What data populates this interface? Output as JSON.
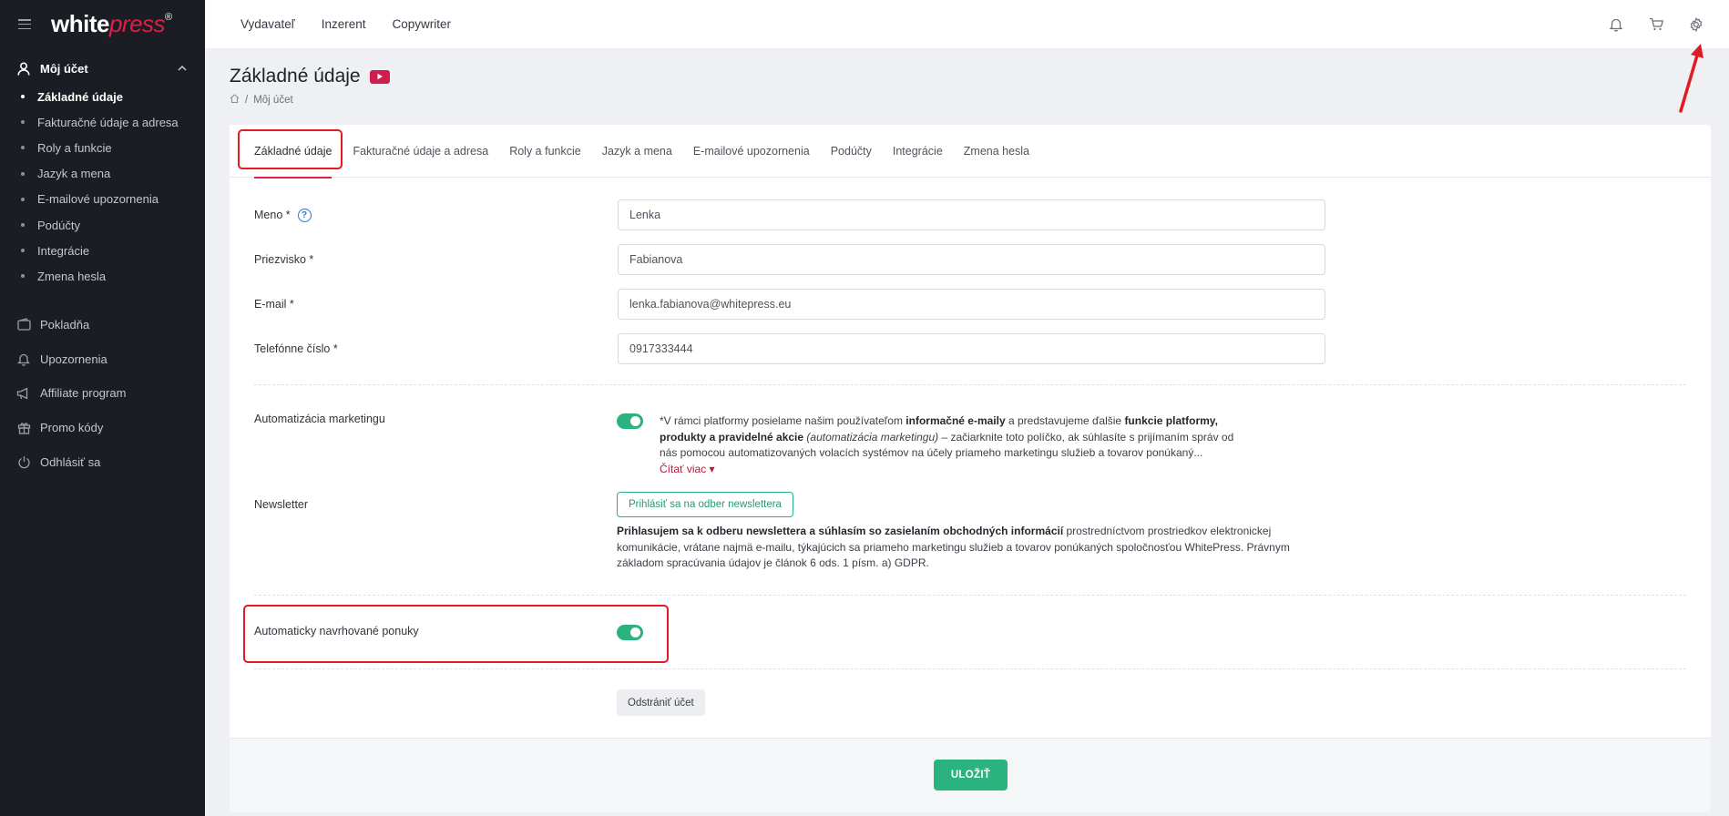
{
  "logo": {
    "main": "white",
    "accent": "press",
    "mark": "®"
  },
  "sidebar": {
    "section": {
      "label": "Môj účet",
      "icon": "user-icon"
    },
    "subitems": [
      {
        "label": "Základné údaje",
        "active": true
      },
      {
        "label": "Fakturačné údaje a adresa"
      },
      {
        "label": "Roly a funkcie"
      },
      {
        "label": "Jazyk a mena"
      },
      {
        "label": "E-mailové upozornenia"
      },
      {
        "label": "Podúčty"
      },
      {
        "label": "Integrácie"
      },
      {
        "label": "Zmena hesla"
      }
    ],
    "main": [
      {
        "label": "Pokladňa",
        "icon": "wallet-icon"
      },
      {
        "label": "Upozornenia",
        "icon": "bell-icon"
      },
      {
        "label": "Affiliate program",
        "icon": "megaphone-icon"
      },
      {
        "label": "Promo kódy",
        "icon": "gift-icon"
      },
      {
        "label": "Odhlásiť sa",
        "icon": "power-icon"
      }
    ]
  },
  "topnav": [
    "Vydavateľ",
    "Inzerent",
    "Copywriter"
  ],
  "page": {
    "title": "Základné údaje",
    "breadcrumb": {
      "sep": "/",
      "current": "Môj účet"
    }
  },
  "tabs": [
    "Základné údaje",
    "Fakturačné údaje a adresa",
    "Roly a funkcie",
    "Jazyk a mena",
    "E-mailové upozornenia",
    "Podúčty",
    "Integrácie",
    "Zmena hesla"
  ],
  "form": {
    "name": {
      "label": "Meno *",
      "value": "Lenka",
      "help": "?"
    },
    "surname": {
      "label": "Priezvisko *",
      "value": "Fabianova"
    },
    "email": {
      "label": "E-mail *",
      "value": "lenka.fabianova@whitepress.eu"
    },
    "phone": {
      "label": "Telefónne číslo *",
      "value": "0917333444"
    }
  },
  "marketing": {
    "label": "Automatizácia marketingu",
    "enabled": true,
    "text_prefix": "*V rámci platformy posielame našim používateľom ",
    "text_b1": "informačné e-maily",
    "text_mid1": " a predstavujeme ďalšie ",
    "text_b2": "funkcie platformy, produkty a pravidelné akcie",
    "text_i": " (automatizácia marketingu)",
    "text_rest": " – začiarknite toto políčko, ak súhlasíte s prijímaním správ od nás pomocou automatizovaných volacích systémov na účely priameho marketingu služieb a tovarov ponúkaný...",
    "read_more": "Čítať viac ▾"
  },
  "newsletter": {
    "label": "Newsletter",
    "button": "Prihlásiť sa na odber newslettera",
    "text_b": "Prihlasujem sa k odberu newslettera a súhlasím so zasielaním obchodných informácií",
    "text_rest": " prostredníctvom prostriedkov elektronickej komunikácie, vrátane najmä e-mailu, týkajúcich sa priameho marketingu služieb a tovarov ponúkaných spoločnosťou WhitePress. Právnym základom spracúvania údajov je článok 6 ods. 1 písm. a) GDPR."
  },
  "auto_offers": {
    "label": "Automaticky navrhované ponuky",
    "enabled": true
  },
  "actions": {
    "delete": "Odstrániť účet",
    "save": "ULOŽIŤ"
  },
  "colors": {
    "accent": "#e11d48",
    "success": "#2bb37f",
    "sidebar_bg": "#1a1d23",
    "highlight": "#e01b24"
  }
}
